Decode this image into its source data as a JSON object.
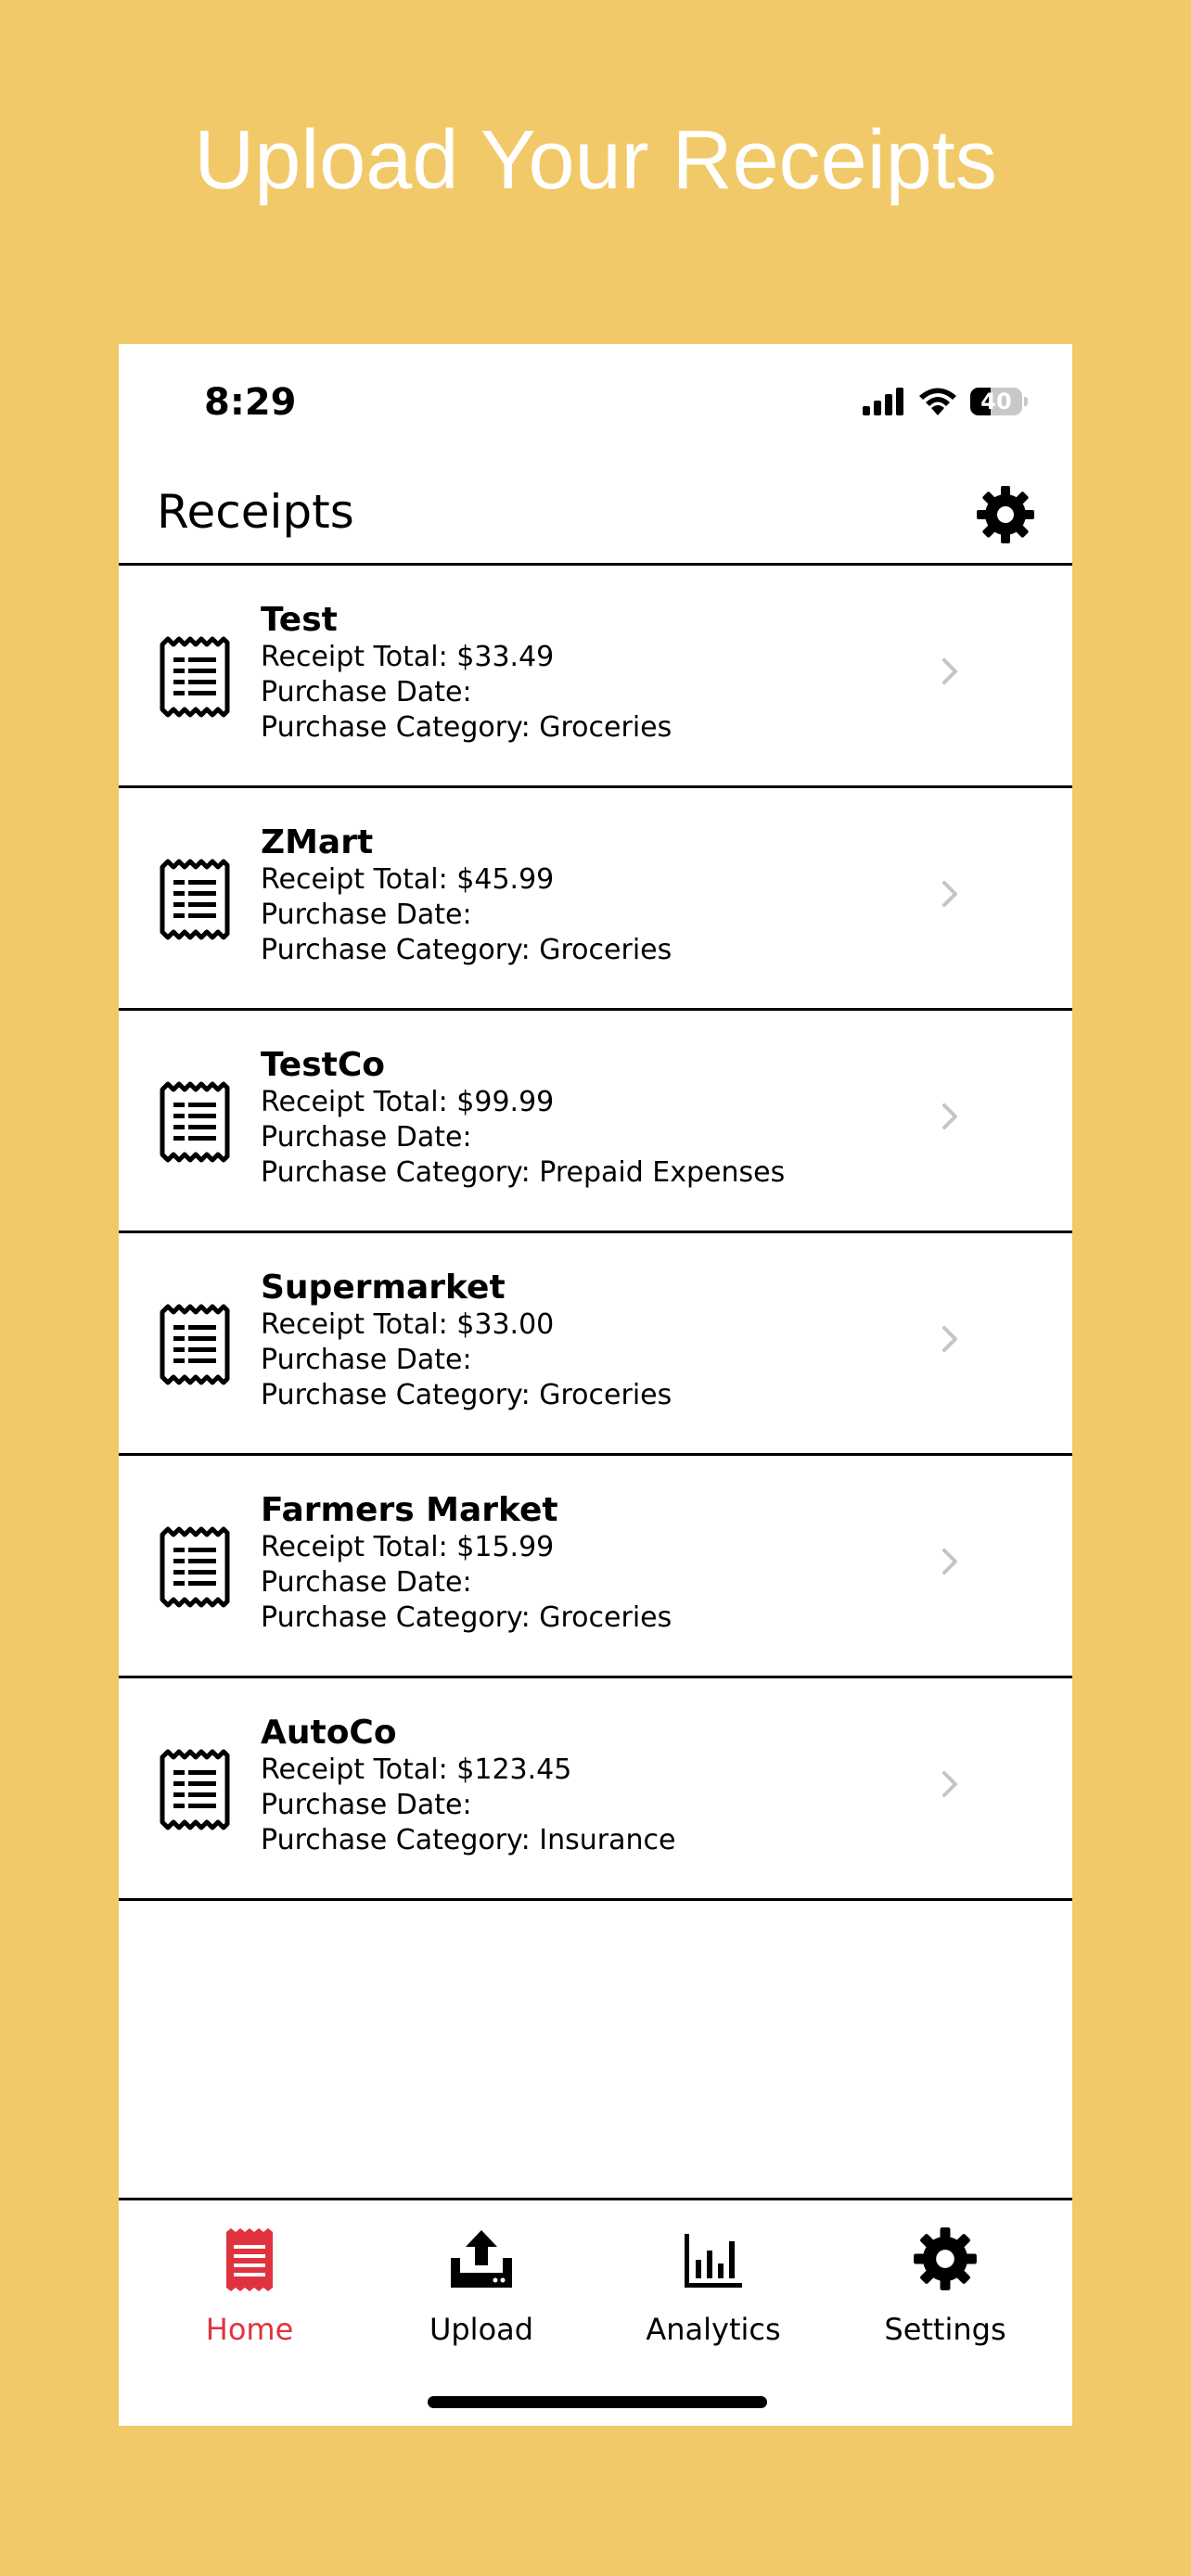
{
  "promo": {
    "title": "Upload Your Receipts"
  },
  "status_bar": {
    "time": "8:29",
    "battery": "40",
    "battery_level": 0.4
  },
  "nav": {
    "title": "Receipts",
    "settings_icon": "gear-icon"
  },
  "receipts": [
    {
      "name": "Test",
      "total": "Receipt Total: $33.49",
      "date": "Purchase Date:",
      "category": "Purchase Category: Groceries"
    },
    {
      "name": "ZMart",
      "total": "Receipt Total: $45.99",
      "date": "Purchase Date:",
      "category": "Purchase Category: Groceries"
    },
    {
      "name": "TestCo",
      "total": "Receipt Total: $99.99",
      "date": "Purchase Date:",
      "category": "Purchase Category: Prepaid Expenses"
    },
    {
      "name": "Supermarket",
      "total": "Receipt Total: $33.00",
      "date": "Purchase Date:",
      "category": "Purchase Category: Groceries"
    },
    {
      "name": "Farmers Market",
      "total": "Receipt Total: $15.99",
      "date": "Purchase Date:",
      "category": "Purchase Category: Groceries"
    },
    {
      "name": "AutoCo",
      "total": "Receipt Total: $123.45",
      "date": "Purchase Date:",
      "category": "Purchase Category: Insurance"
    }
  ],
  "tabs": [
    {
      "label": "Home",
      "icon": "receipt-icon",
      "active": true
    },
    {
      "label": "Upload",
      "icon": "upload-icon",
      "active": false
    },
    {
      "label": "Analytics",
      "icon": "bar-chart-icon",
      "active": false
    },
    {
      "label": "Settings",
      "icon": "gear-icon",
      "active": false
    }
  ],
  "colors": {
    "background": "#F1C968",
    "accent": "#E0333F",
    "text": "#000000",
    "chevron": "#C4C4C9"
  }
}
